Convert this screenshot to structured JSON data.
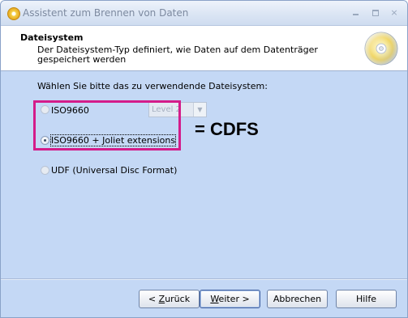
{
  "window": {
    "title": "Assistent zum Brennen von Daten",
    "controls": {
      "minimize": "minimize",
      "maximize": "maximize",
      "close": "×"
    }
  },
  "header": {
    "title": "Dateisystem",
    "description": "Der Dateisystem-Typ definiert, wie Daten auf dem Datenträger gespeichert werden"
  },
  "main": {
    "prompt": "Wählen Sie bitte das zu verwendende Dateisystem:",
    "options": [
      {
        "label": "ISO9660",
        "selected": false,
        "enabled": true
      },
      {
        "label": "ISO9660 + Joliet extensions",
        "selected": true,
        "enabled": true,
        "focused": true
      },
      {
        "label": "UDF (Universal Disc Format)",
        "selected": false,
        "enabled": false
      }
    ],
    "level_select": {
      "value": "Level 2",
      "enabled": false
    },
    "annotation": {
      "text": "= CDFS",
      "highlight_color": "#d41c8a"
    }
  },
  "buttons": {
    "back": {
      "prefix": "< ",
      "mnemonic": "Z",
      "rest": "urück"
    },
    "next": {
      "mnemonic": "W",
      "rest": "eiter >"
    },
    "cancel": "Abbrechen",
    "help": "Hilfe"
  },
  "colors": {
    "background": "#c4d8f5",
    "header_background": "#ffffff",
    "annotation": "#d41c8a"
  }
}
